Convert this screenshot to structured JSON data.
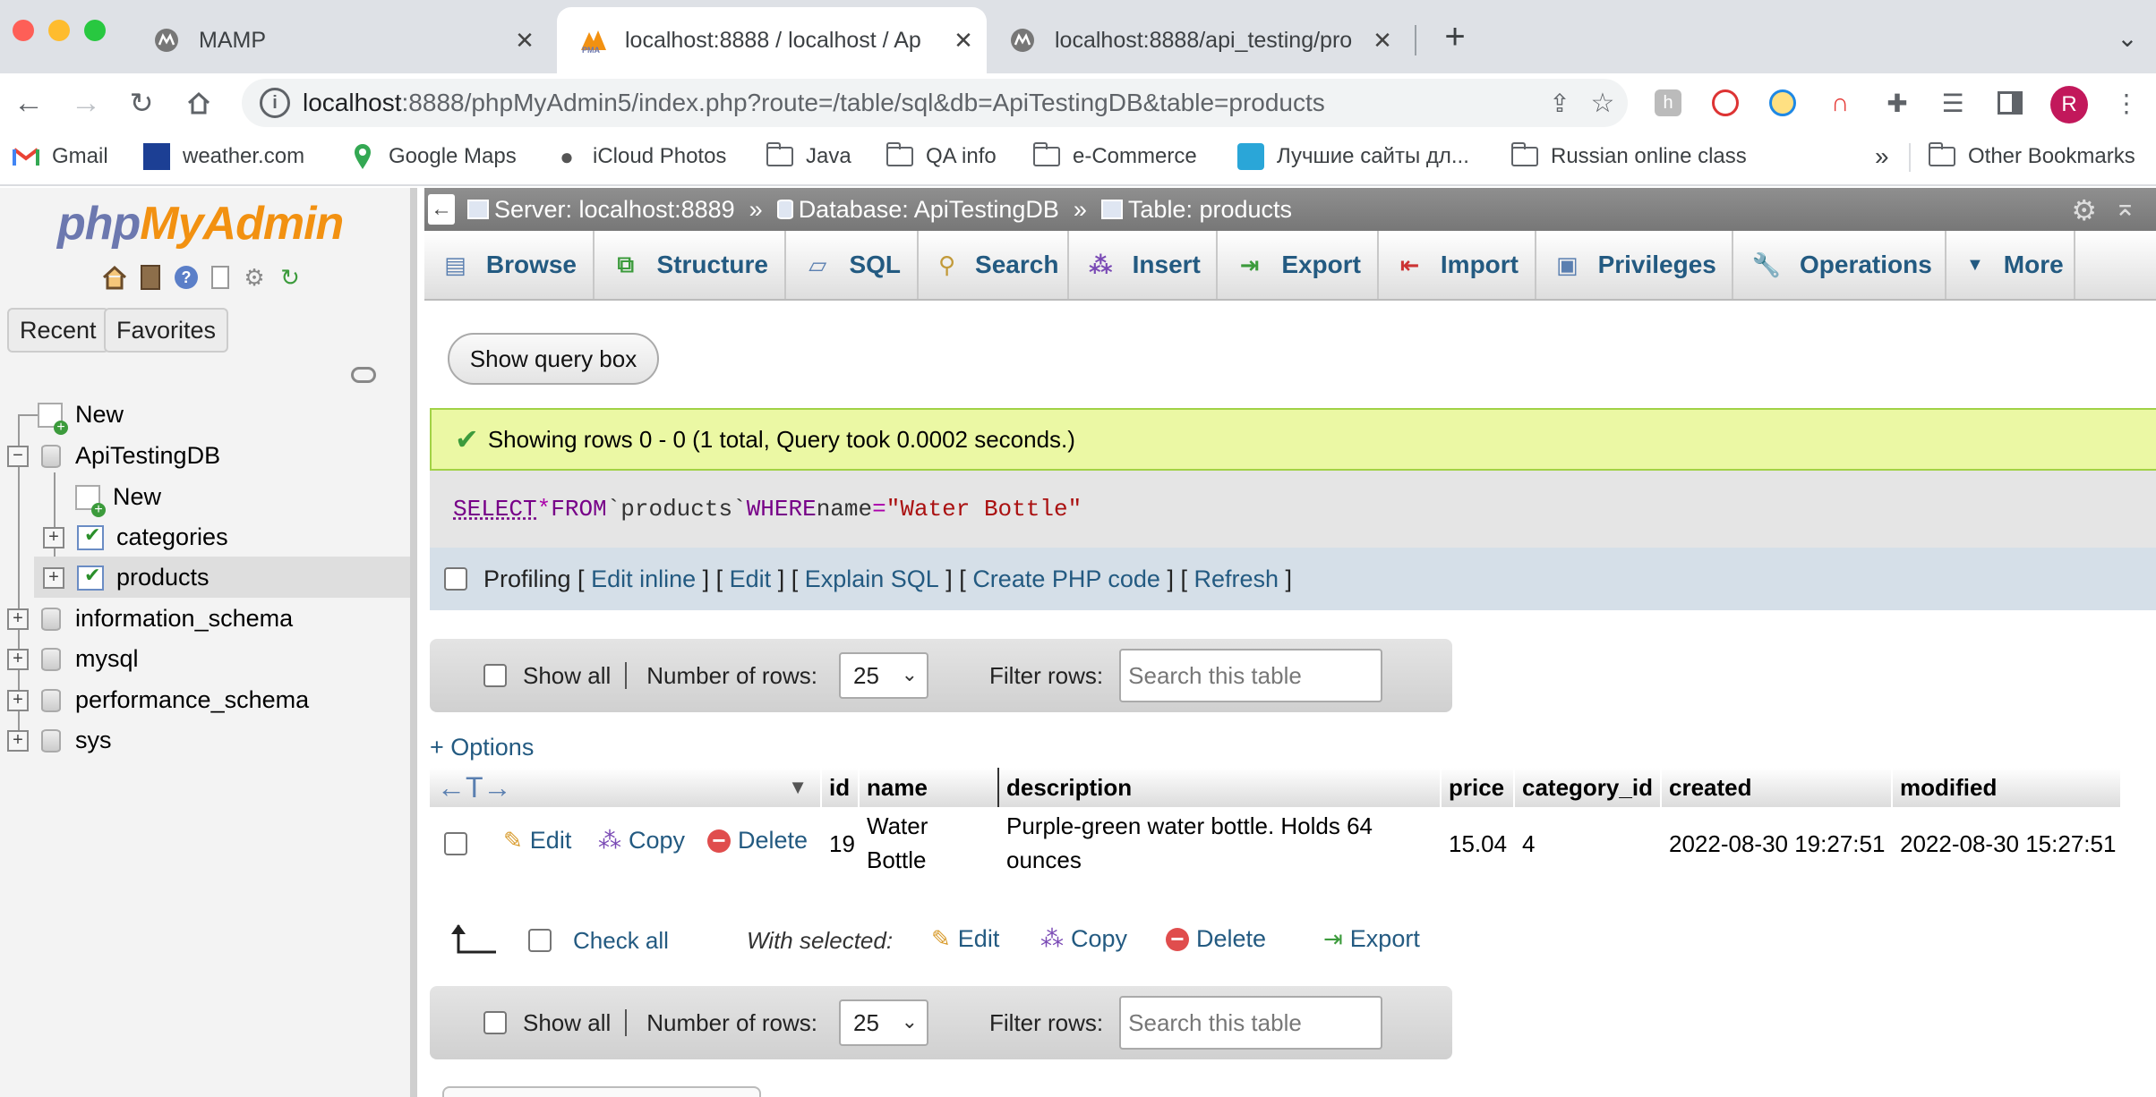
{
  "browser": {
    "tabs": [
      {
        "title": "MAMP",
        "active": false
      },
      {
        "title": "localhost:8888 / localhost / Ap",
        "active": true
      },
      {
        "title": "localhost:8888/api_testing/pro",
        "active": false
      }
    ],
    "new_tab": "+",
    "url_host": "localhost",
    "url_path": ":8888/phpMyAdmin5/index.php?route=/table/sql&db=ApiTestingDB&table=products",
    "profile_initial": "R",
    "bookmarks": [
      "Gmail",
      "weather.com",
      "Google Maps",
      "iCloud Photos",
      "Java",
      "QA info",
      "e-Commerce",
      "Лучшие сайты дл...",
      "Russian online class"
    ],
    "more_bookmarks": "»",
    "other_bookmarks": "Other Bookmarks"
  },
  "sidebar": {
    "logo_php": "php",
    "logo_myadmin": "MyAdmin",
    "tabs": [
      "Recent",
      "Favorites"
    ],
    "tree": {
      "new": "New",
      "databases": [
        {
          "name": "ApiTestingDB",
          "expanded": true,
          "children": [
            "New",
            "categories",
            "products"
          ]
        },
        {
          "name": "information_schema"
        },
        {
          "name": "mysql"
        },
        {
          "name": "performance_schema"
        },
        {
          "name": "sys"
        }
      ]
    }
  },
  "breadcrumb": {
    "server": "Server: localhost:8889",
    "database": "Database: ApiTestingDB",
    "table": "Table: products",
    "separator": "»"
  },
  "menu": [
    "Browse",
    "Structure",
    "SQL",
    "Search",
    "Insert",
    "Export",
    "Import",
    "Privileges",
    "Operations",
    "More"
  ],
  "show_query_box": "Show query box",
  "success_message": "Showing rows 0 - 0 (1 total, Query took 0.0002 seconds.)",
  "sql": {
    "select": "SELECT",
    "star": "*",
    "from": "FROM",
    "table": "`products`",
    "where": "WHERE",
    "column": "name",
    "eq": "=",
    "value": "\"Water Bottle\""
  },
  "profiling": {
    "label": "Profiling",
    "links": [
      "Edit inline",
      "Edit",
      "Explain SQL",
      "Create PHP code",
      "Refresh"
    ]
  },
  "nav": {
    "show_all": "Show all",
    "rows_label": "Number of rows:",
    "rows_value": "25",
    "filter_label": "Filter rows:",
    "filter_placeholder": "Search this table"
  },
  "options_link": "+ Options",
  "table": {
    "columns": [
      "id",
      "name",
      "description",
      "price",
      "category_id",
      "created",
      "modified"
    ],
    "row_actions": [
      "Edit",
      "Copy",
      "Delete"
    ],
    "rows": [
      {
        "id": "19",
        "name_line1": "Water",
        "name_line2": "Bottle",
        "desc_line1": "Purple-green water bottle. Holds 64",
        "desc_line2": "ounces",
        "price": "15.04",
        "category_id": "4",
        "created": "2022-08-30 19:27:51",
        "modified": "2022-08-30 15:27:51"
      }
    ]
  },
  "bulk": {
    "check_all": "Check all",
    "with_selected": "With selected:",
    "actions": [
      "Edit",
      "Copy",
      "Delete",
      "Export"
    ]
  },
  "colors": {
    "link": "#235a81",
    "success_bg": "#ebf8a4",
    "logo_php": "#6c78af",
    "logo_myadmin": "#f29111"
  }
}
